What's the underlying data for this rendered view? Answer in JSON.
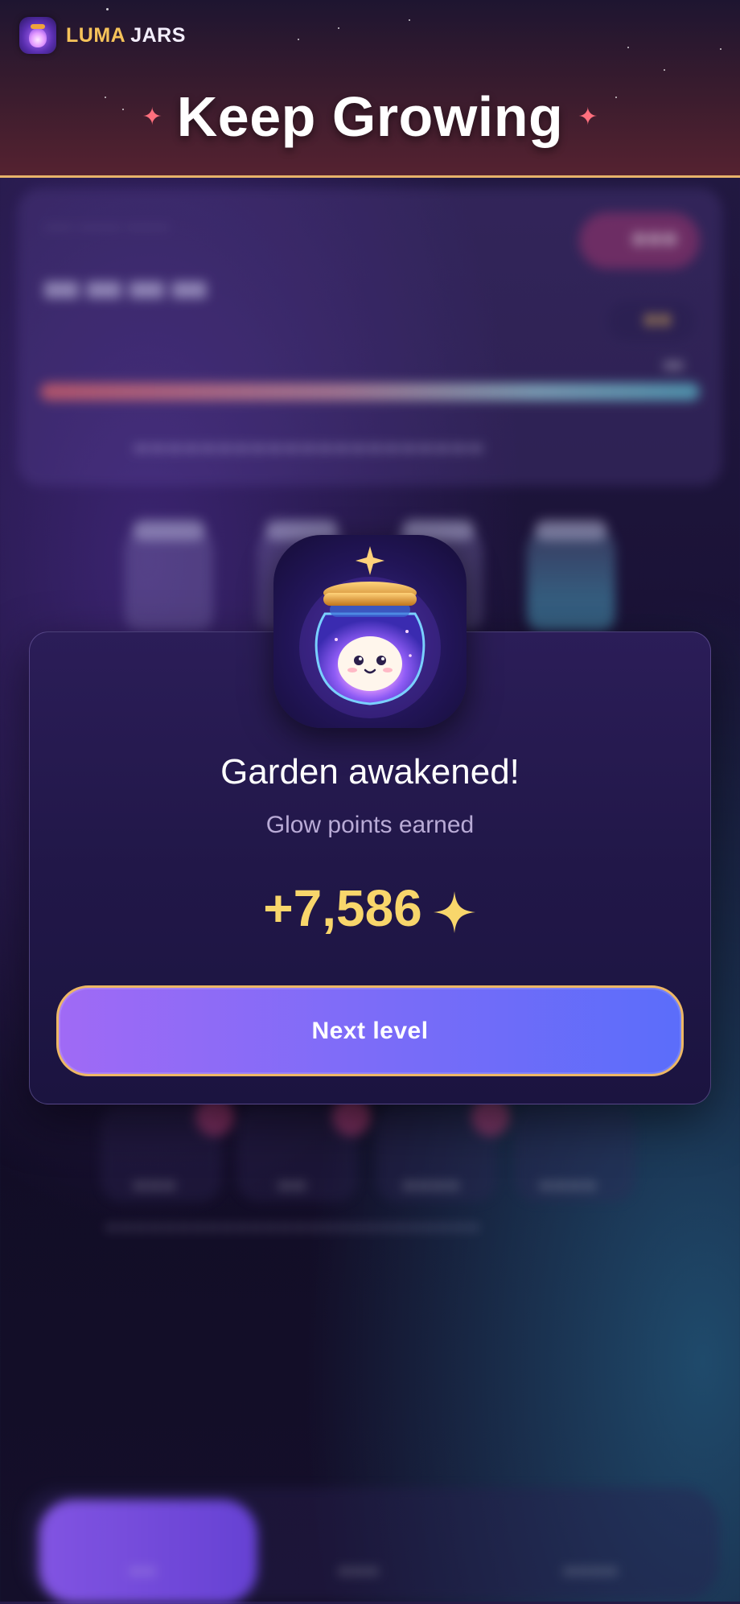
{
  "brand": {
    "name_part1": "LUMA",
    "name_part2": "JARS"
  },
  "header": {
    "title": "Keep Growing"
  },
  "modal": {
    "title": "Garden awakened!",
    "subtitle": "Glow points earned",
    "points": "+7,586",
    "next_button_label": "Next level"
  },
  "colors": {
    "accent_gold": "#f8d66b",
    "button_start": "#a06af5",
    "button_end": "#5b6dfa",
    "button_border": "#eeb865",
    "header_border": "#e8b36a",
    "spark_pink": "#ff6f7d"
  },
  "icons": [
    "jar-spirit-logo",
    "sparkle-icon",
    "glowing-jar-icon",
    "four-point-star-icon"
  ]
}
